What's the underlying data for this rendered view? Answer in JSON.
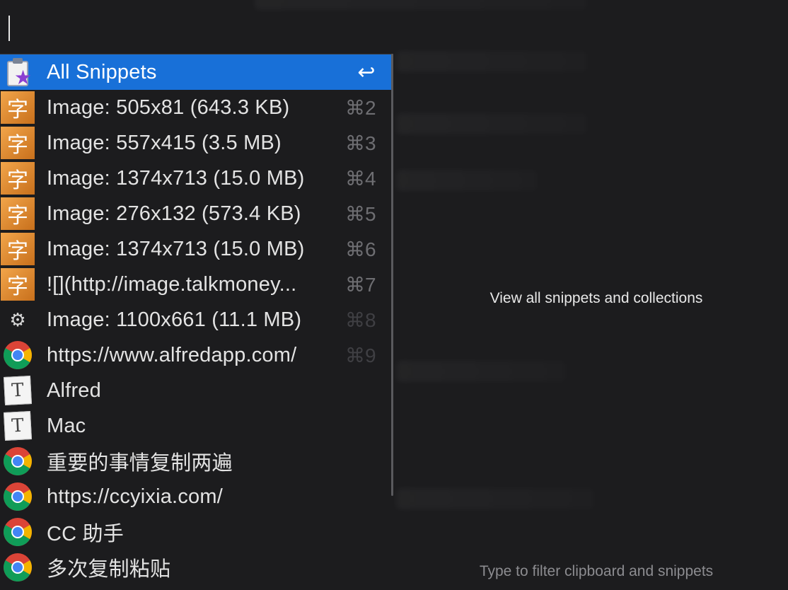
{
  "search": {
    "query": ""
  },
  "results": [
    {
      "title": "All Snippets",
      "shortcut": "↩",
      "icon": "clipboard-star-icon",
      "selected": true
    },
    {
      "title": "Image: 505x81 (643.3 KB)",
      "shortcut": "⌘2",
      "icon": "image-calligraphy-icon"
    },
    {
      "title": "Image: 557x415 (3.5 MB)",
      "shortcut": "⌘3",
      "icon": "image-calligraphy-icon"
    },
    {
      "title": "Image: 1374x713 (15.0 MB)",
      "shortcut": "⌘4",
      "icon": "image-calligraphy-icon"
    },
    {
      "title": "Image: 276x132 (573.4 KB)",
      "shortcut": "⌘5",
      "icon": "image-calligraphy-icon"
    },
    {
      "title": "Image: 1374x713 (15.0 MB)",
      "shortcut": "⌘6",
      "icon": "image-calligraphy-icon"
    },
    {
      "title": "![](http://image.talkmoney...",
      "shortcut": "⌘7",
      "icon": "image-calligraphy-icon"
    },
    {
      "title": "Image: 1100x661 (11.1 MB)",
      "shortcut": "⌘8",
      "icon": "gear-icon"
    },
    {
      "title": "https://www.alfredapp.com/",
      "shortcut": "⌘9",
      "icon": "chrome-icon"
    },
    {
      "title": "Alfred",
      "shortcut": "",
      "icon": "text-document-icon"
    },
    {
      "title": "Mac",
      "shortcut": "",
      "icon": "text-document-icon"
    },
    {
      "title": "重要的事情复制两遍",
      "shortcut": "",
      "icon": "chrome-icon"
    },
    {
      "title": "https://ccyixia.com/",
      "shortcut": "",
      "icon": "chrome-icon"
    },
    {
      "title": "CC 助手",
      "shortcut": "",
      "icon": "chrome-icon"
    },
    {
      "title": "多次复制粘贴",
      "shortcut": "",
      "icon": "chrome-icon"
    }
  ],
  "preview": {
    "description": "View all snippets and collections"
  },
  "hint": "Type to filter clipboard and snippets",
  "colors": {
    "background": "#1c1c1e",
    "selection": "#1870d8",
    "text": "#e3e3e3",
    "shortcut": "#6e6e72"
  }
}
